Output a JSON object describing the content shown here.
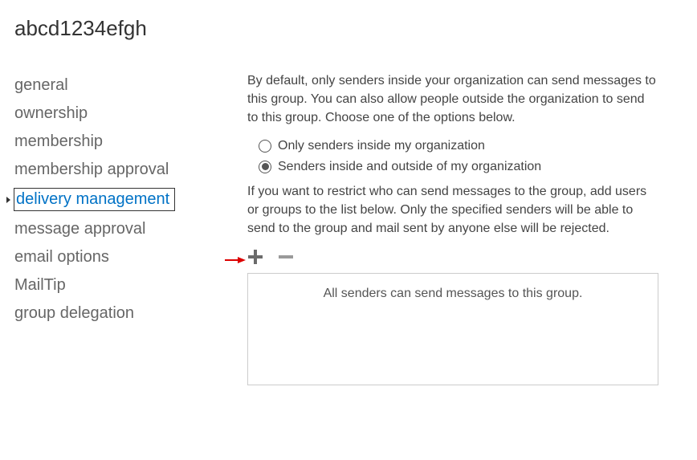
{
  "title": "abcd1234efgh",
  "sidebar": {
    "items": [
      {
        "label": "general"
      },
      {
        "label": "ownership"
      },
      {
        "label": "membership"
      },
      {
        "label": "membership approval"
      },
      {
        "label": "delivery management"
      },
      {
        "label": "message approval"
      },
      {
        "label": "email options"
      },
      {
        "label": "MailTip"
      },
      {
        "label": "group delegation"
      }
    ],
    "activeIndex": 4
  },
  "content": {
    "description1": "By default, only senders inside your organization can send messages to this group. You can also allow people outside the organization to send to this group. Choose one of the options below.",
    "radios": {
      "option1": "Only senders inside my organization",
      "option2": "Senders inside and outside of my organization",
      "selected": "option2"
    },
    "description2": "If you want to restrict who can send messages to the group, add users or groups to the list below. Only the specified senders will be able to send to the group and mail sent by anyone else will be rejected.",
    "emptyListText": "All senders can send messages to this group."
  }
}
